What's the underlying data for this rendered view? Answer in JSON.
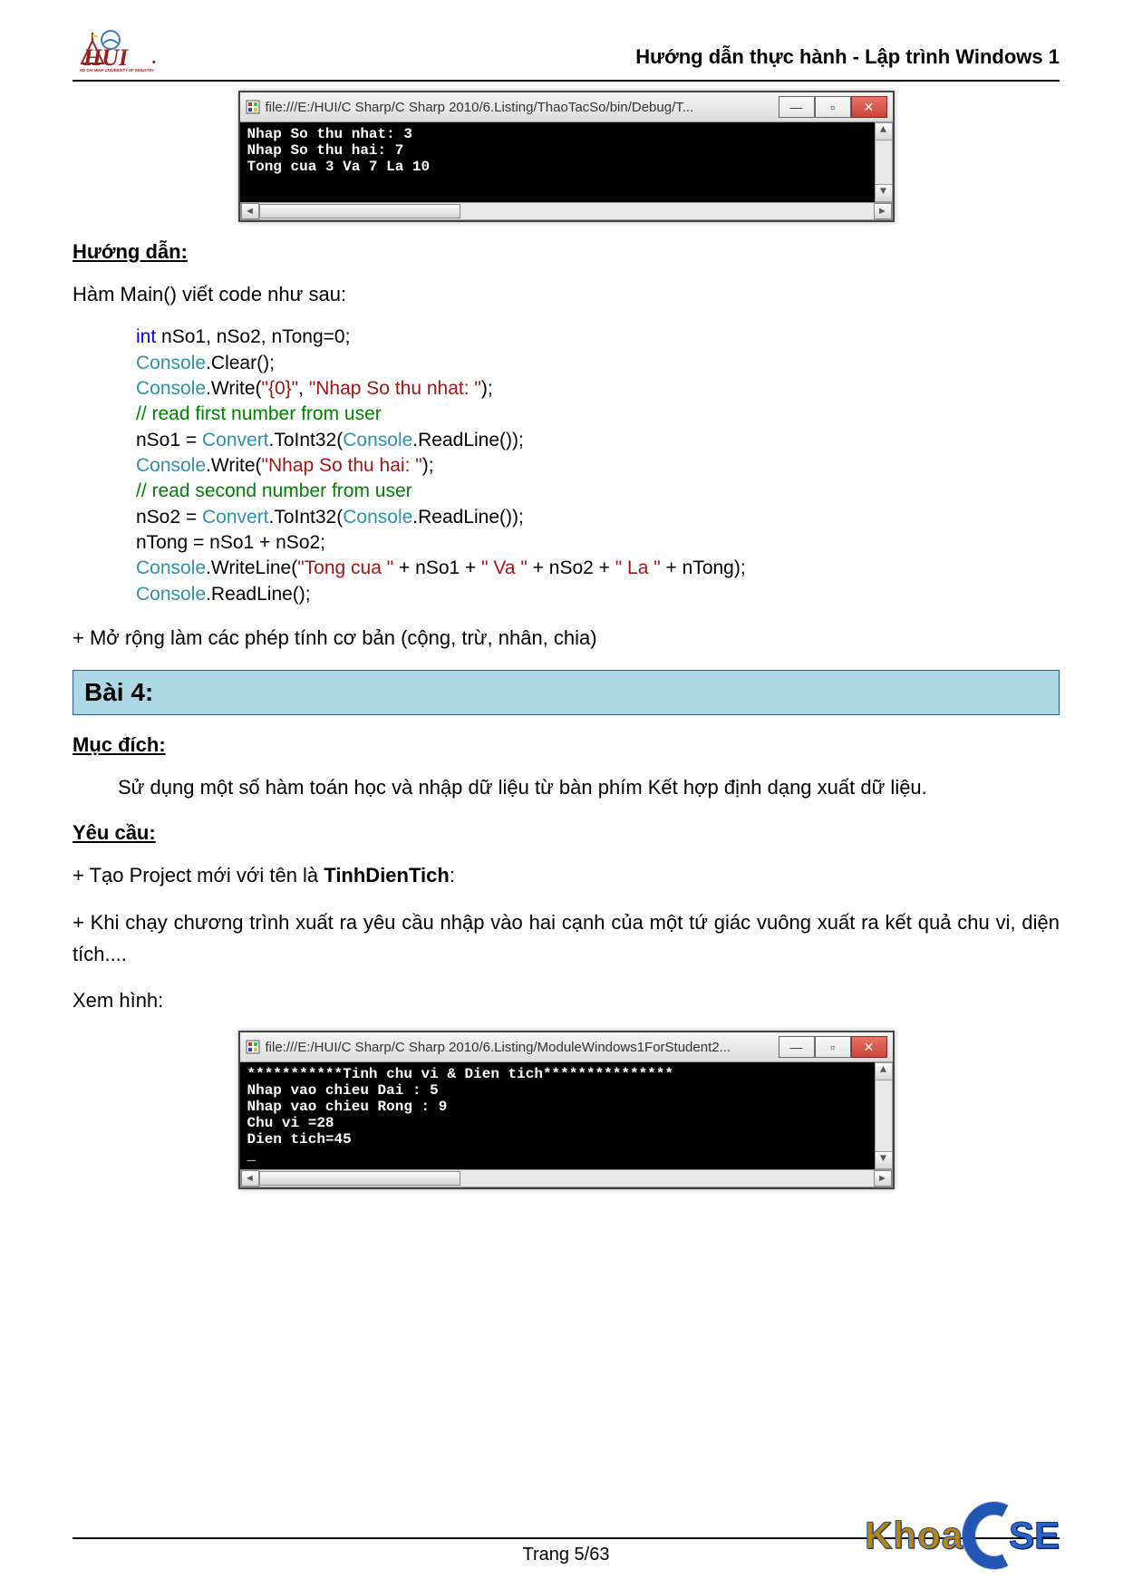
{
  "header": {
    "title": "Hướng dẫn thực hành  - Lập trình Windows 1"
  },
  "console1": {
    "title": "file:///E:/HUI/C Sharp/C Sharp 2010/6.Listing/ThaoTacSo/bin/Debug/T...",
    "lines": "Nhap So thu nhat: 3\nNhap So thu hai: 7\nTong cua 3 Va 7 La 10"
  },
  "sec_guide": {
    "heading": "Hướng dẫn:",
    "intro": "Hàm Main() viết code như sau:"
  },
  "code": {
    "l1_kw": "int",
    "l1_rest": " nSo1, nSo2, nTong=0;",
    "l2_c": "Console",
    "l2_r": ".Clear();",
    "l3_c": "Console",
    "l3_a": ".Write(",
    "l3_s1": "\"{0}\"",
    "l3_m": ", ",
    "l3_s2": "\"Nhap So thu nhat: \"",
    "l3_e": ");",
    "l4": "// read first number from user",
    "l5_a": "nSo1 = ",
    "l5_cv": "Convert",
    "l5_b": ".ToInt32(",
    "l5_cn": "Console",
    "l5_c": ".ReadLine());",
    "l6_c": "Console",
    "l6_a": ".Write(",
    "l6_s": "\"Nhap So thu hai: \"",
    "l6_e": ");",
    "l7": "// read second number from user",
    "l8_a": "nSo2 = ",
    "l8_cv": "Convert",
    "l8_b": ".ToInt32(",
    "l8_cn": "Console",
    "l8_c": ".ReadLine());",
    "l9": "nTong = nSo1 + nSo2;",
    "l10_c": "Console",
    "l10_a": ".WriteLine(",
    "l10_s1": "\"Tong cua \"",
    "l10_b": " + nSo1 + ",
    "l10_s2": "\" Va \"",
    "l10_c2": " + nSo2 + ",
    "l10_s3": "\" La \"",
    "l10_d": " + nTong);",
    "l11_c": "Console",
    "l11_r": ".ReadLine();"
  },
  "expand": "+ Mở rộng làm các phép tính cơ bản (cộng, trừ, nhân, chia)",
  "bai4": {
    "title": "Bài 4:",
    "muc_dich_h": "Mục đích:",
    "muc_dich": "Sử dụng một số hàm toán học và nhập dữ liệu từ bàn phím Kết hợp định dạng xuất dữ liệu.",
    "yeu_cau_h": "Yêu cầu:",
    "req1_a": "+ Tạo Project mới với tên là ",
    "req1_b": "TinhDienTich",
    "req1_c": ":",
    "req2": "+ Khi chạy chương trình xuất ra yêu cầu nhập vào hai cạnh của một tứ giác vuông xuất ra kết quả chu vi, diện tích....",
    "xem_hinh": "Xem hình:"
  },
  "console2": {
    "title": "file:///E:/HUI/C Sharp/C Sharp 2010/6.Listing/ModuleWindows1ForStudent2...",
    "lines": "***********Tinh chu vi & Dien tich***************\nNhap vao chieu Dai : 5\nNhap vao chieu Rong : 9\nChu vi =28\nDien tich=45\n_"
  },
  "footer": {
    "page": "Trang 5/63",
    "khoa": "Khoa",
    "se": "SE"
  }
}
